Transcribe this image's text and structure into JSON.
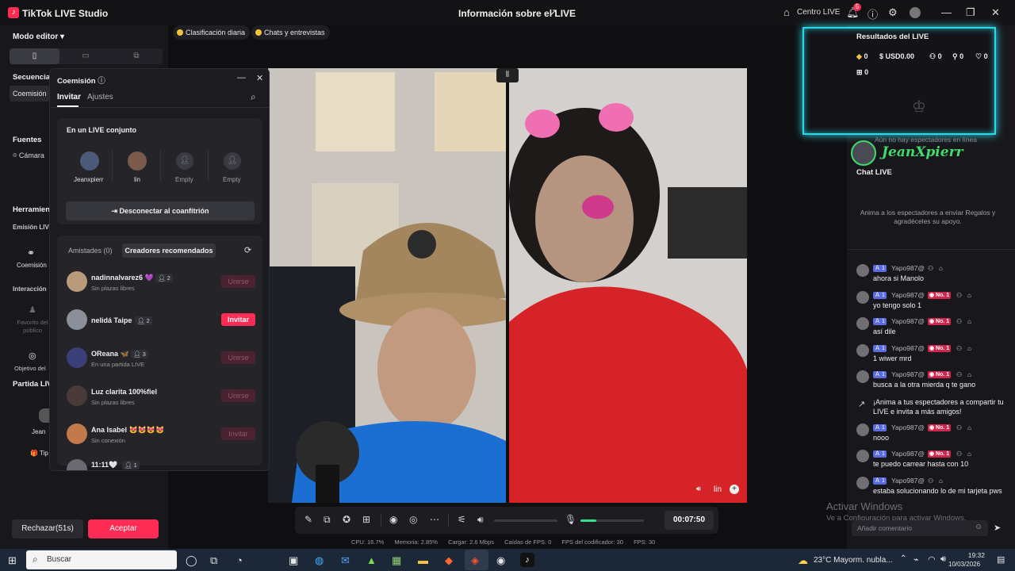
{
  "titlebar": {
    "app_title": "TikTok LIVE Studio",
    "center_title": "Información sobre el LIVE",
    "centro_live": "Centro LIVE",
    "notif_count": "5"
  },
  "chips": {
    "daily_rank": "Clasificación diaria",
    "chats": "Chats y entrevistas"
  },
  "sidebar": {
    "mode": "Modo editor",
    "sequences": "Secuencias",
    "coemission": "Coemisión",
    "sources": "Fuentes",
    "camera": "Cámara",
    "tools": "Herramientas",
    "live_emission": "Emisión LIVE",
    "coemision_tool": "Coemisión",
    "interaction": "Interacción",
    "favorite": "Favorito del público",
    "goal": "Objetivo del",
    "match": "Partida LIVE",
    "jean_short": "Jean",
    "tips": "Tip"
  },
  "popup": {
    "title": "Coemisión",
    "tab_invite": "Invitar",
    "tab_settings": "Ajustes",
    "joint_live": "En un LIVE conjunto",
    "guests": [
      {
        "name": "Jeanxpierr"
      },
      {
        "name": "lin"
      },
      {
        "name": "Empty"
      },
      {
        "name": "Empty"
      }
    ],
    "disconnect": "Desconectar al coanfitrión",
    "friends_tab": "Amistades (0)",
    "recommended_tab": "Creadores recomendados",
    "creators": [
      {
        "name": "nadinnalvarez6 💜",
        "count": "2",
        "sub": "Sin plazas libres",
        "action": "Unirse",
        "enabled": false,
        "color": "#b99a7a"
      },
      {
        "name": "nelidá Taipe",
        "count": "2",
        "sub": "",
        "action": "Invitar",
        "enabled": true,
        "color": "#8a8f9a"
      },
      {
        "name": "OReana 🦋",
        "count": "3",
        "sub": "En una partida LIVE",
        "action": "Unirse",
        "enabled": false,
        "color": "#3a3f7a"
      },
      {
        "name": "Luz clarita 100%fiel",
        "count": "",
        "sub": "Sin plazas libres",
        "action": "Unirse",
        "enabled": false,
        "color": "#4a3a3a"
      },
      {
        "name": "Ana Isabel 😻😻😻😻",
        "count": "",
        "sub": "Sin conexión",
        "action": "Invitar",
        "enabled": false,
        "color": "#c27a4a"
      },
      {
        "name": "11:11🤍",
        "count": "1",
        "sub": "",
        "action": "Invitar",
        "enabled": false,
        "color": "#6a6a72"
      }
    ]
  },
  "bottom_buttons": {
    "reject": "Rechazar(51s)",
    "accept": "Aceptar"
  },
  "video": {
    "right_label": "lin"
  },
  "controls": {
    "timer": "00:07:50",
    "mic_level": 0.25
  },
  "stats": {
    "cpu": "CPU:  16.7%",
    "memory": "Memoria:  2.85%",
    "upload": "Cargar:  2.6 Mbps",
    "fps_drops": "Caídas de FPS:  0",
    "encoder_fps": "FPS del codificador:  30",
    "fps": "FPS:  30"
  },
  "results": {
    "title": "Resultados del LIVE",
    "coins": "0",
    "usd": "USD0.00",
    "viewers": "0",
    "followers": "0",
    "likes": "0",
    "gifts": "0",
    "no_viewers": "Aún no hay espectadores en línea",
    "overlay_name": "JeanXpierr"
  },
  "chat": {
    "title": "Chat LIVE",
    "prompt": "Anima a los espectadores a enviar Regalos y agradéceles su apoyo.",
    "messages": [
      {
        "user": "Yapo987@",
        "text": "ahora si Manolo",
        "no1": false
      },
      {
        "user": "Yapo987@",
        "text": "yo tengo solo 1",
        "no1": true
      },
      {
        "user": "Yapo987@",
        "text": "así dile",
        "no1": true
      },
      {
        "user": "Yapo987@",
        "text": "1 wiwer mrd",
        "no1": true
      },
      {
        "user": "Yapo987@",
        "text": "busca a la otra mierda q te gano",
        "no1": true
      }
    ],
    "share_prompt": "¡Anima a tus espectadores a compartir tu LIVE e invita a más amigos!",
    "messages2": [
      {
        "user": "Yapo987@",
        "text": "nooo",
        "no1": true
      },
      {
        "user": "Yapo987@",
        "text": "te puedo carrear hasta con 10",
        "no1": true
      },
      {
        "user": "Yapo987@",
        "text": "estaba solucionando lo de mi tarjeta pws",
        "no1": false
      }
    ],
    "level": "1",
    "no1_label": "No. 1",
    "input_placeholder": "Añadir comentario"
  },
  "watermark": {
    "line1": "Activar Windows",
    "line2": "Ve a Configuración para activar Windows."
  },
  "taskbar": {
    "search": "Buscar",
    "weather": "23°C  Mayorm. nubla...",
    "time": "19:32",
    "date": "10/03/2026"
  },
  "colors": {
    "accent": "#fe2c55",
    "glow": "#2fd7e6"
  }
}
